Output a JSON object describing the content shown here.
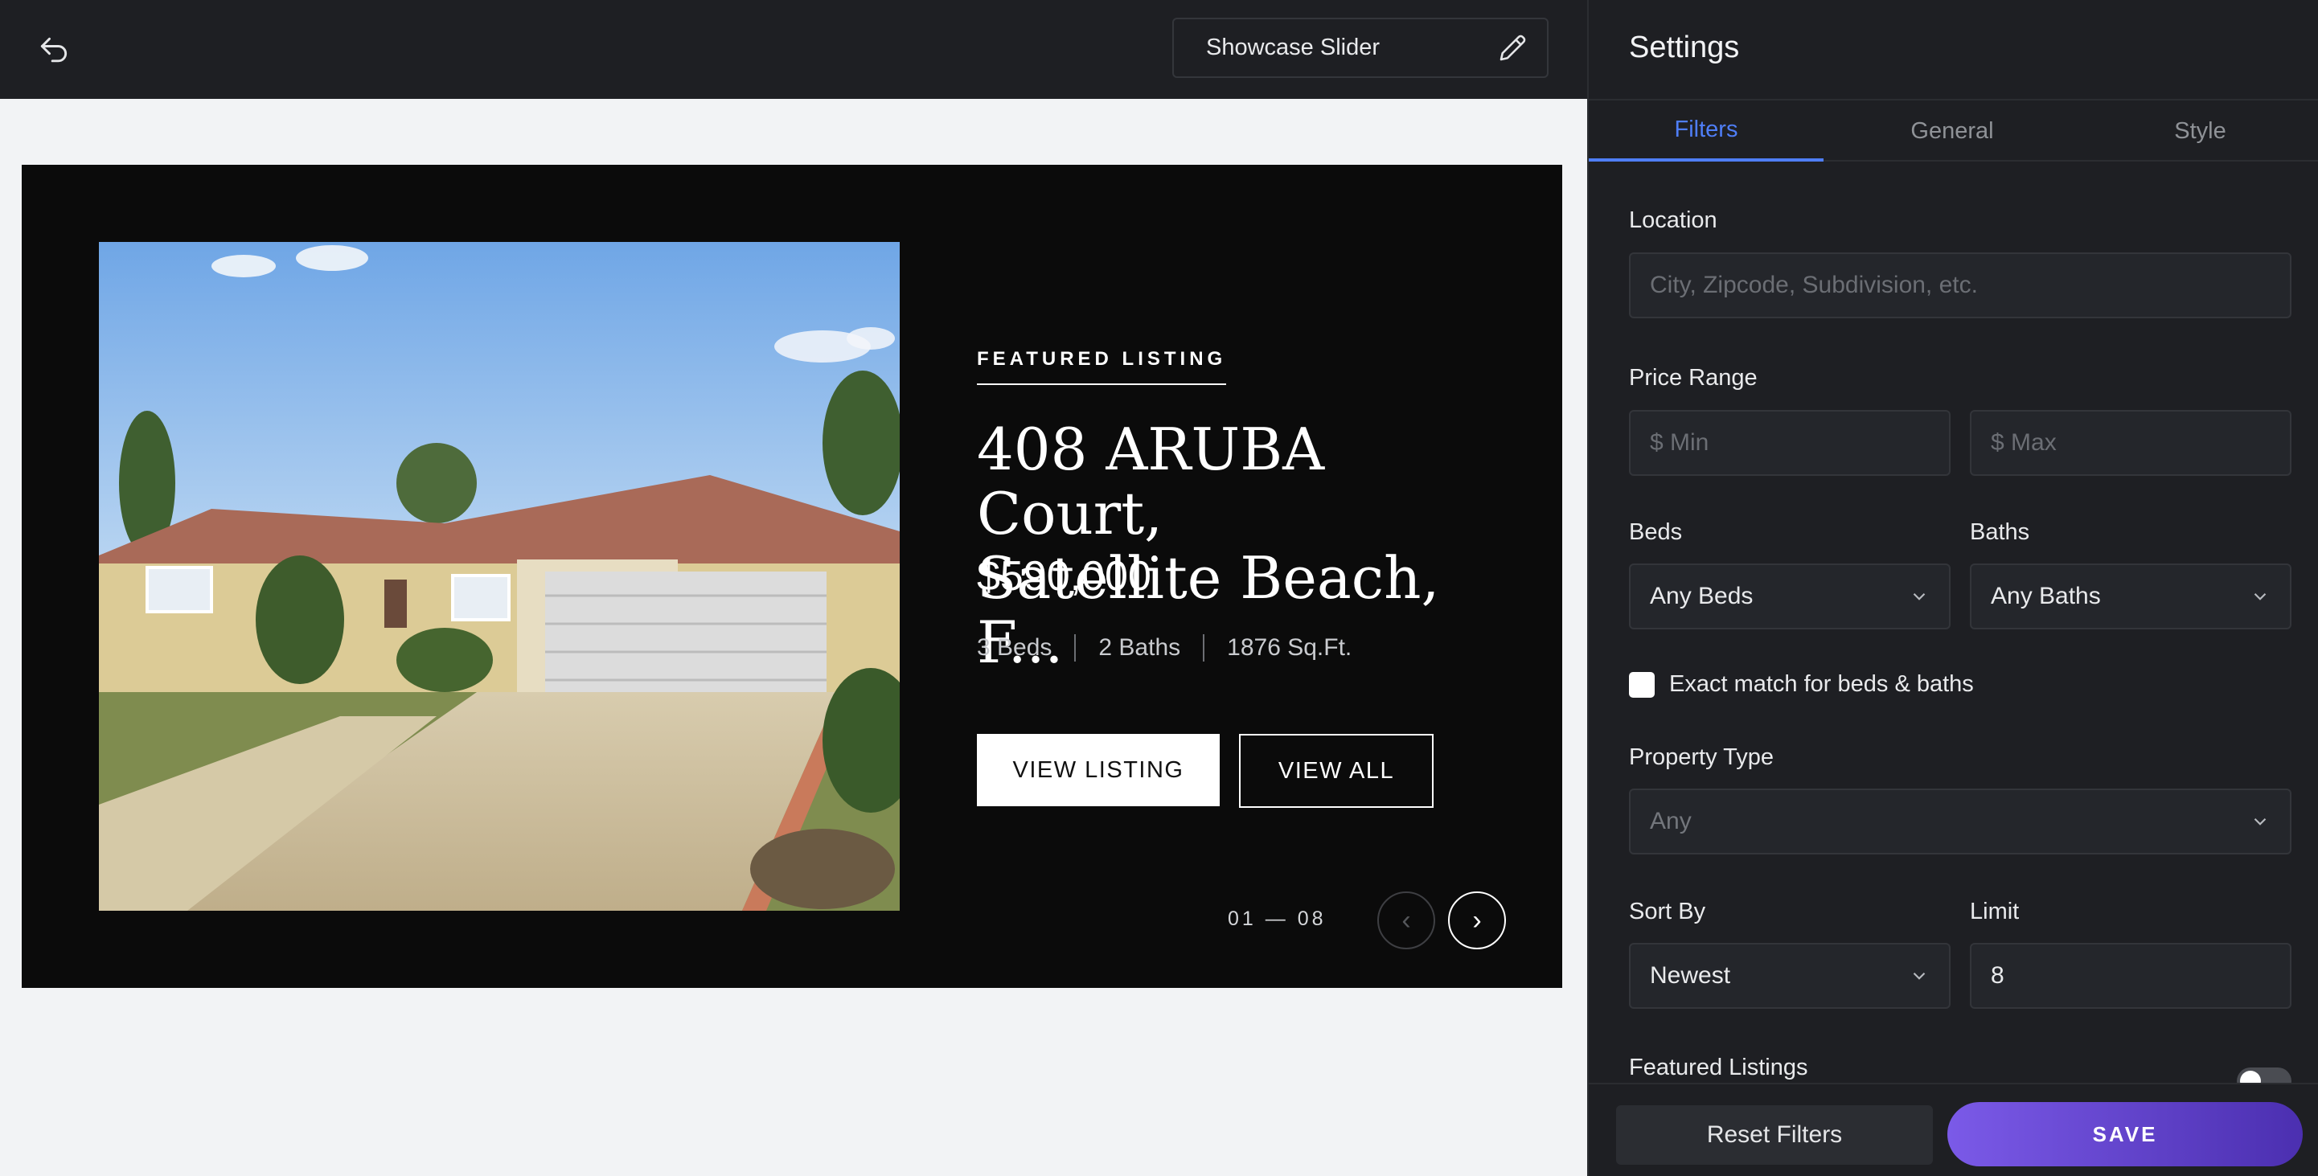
{
  "editor": {
    "widget_name": "Showcase Slider"
  },
  "listing": {
    "eyebrow": "FEATURED LISTING",
    "title_line1": "408 ARUBA Court,",
    "title_line2": "Satellite Beach, F...",
    "price": "$590,000",
    "beds": "3 Beds",
    "baths": "2 Baths",
    "sqft": "1876 Sq.Ft.",
    "view_listing": "VIEW LISTING",
    "view_all": "VIEW ALL",
    "counter": "01 — 08",
    "prev_icon": "‹",
    "next_icon": "›"
  },
  "settings": {
    "title": "Settings",
    "tabs": [
      {
        "label": "Filters",
        "active": true
      },
      {
        "label": "General",
        "active": false
      },
      {
        "label": "Style",
        "active": false
      }
    ],
    "location": {
      "label": "Location",
      "placeholder": "City, Zipcode, Subdivision, etc."
    },
    "price_range": {
      "label": "Price Range",
      "min_placeholder": "$ Min",
      "max_placeholder": "$ Max"
    },
    "beds": {
      "label": "Beds",
      "value": "Any Beds"
    },
    "baths": {
      "label": "Baths",
      "value": "Any Baths"
    },
    "exact_match": {
      "label": "Exact match for beds & baths",
      "checked": false
    },
    "property_type": {
      "label": "Property Type",
      "value": "Any"
    },
    "sort_by": {
      "label": "Sort By",
      "value": "Newest"
    },
    "limit": {
      "label": "Limit",
      "value": "8"
    },
    "featured": {
      "label": "Featured Listings",
      "enabled": false
    },
    "reset_label": "Reset Filters",
    "save_label": "SAVE"
  },
  "colors": {
    "accent": "#4f7ef7",
    "save_gradient_start": "#7b5ae8",
    "save_gradient_end": "#4b2fb0",
    "panel_bg": "#1e1f23",
    "slider_bg": "#0b0b0b"
  }
}
